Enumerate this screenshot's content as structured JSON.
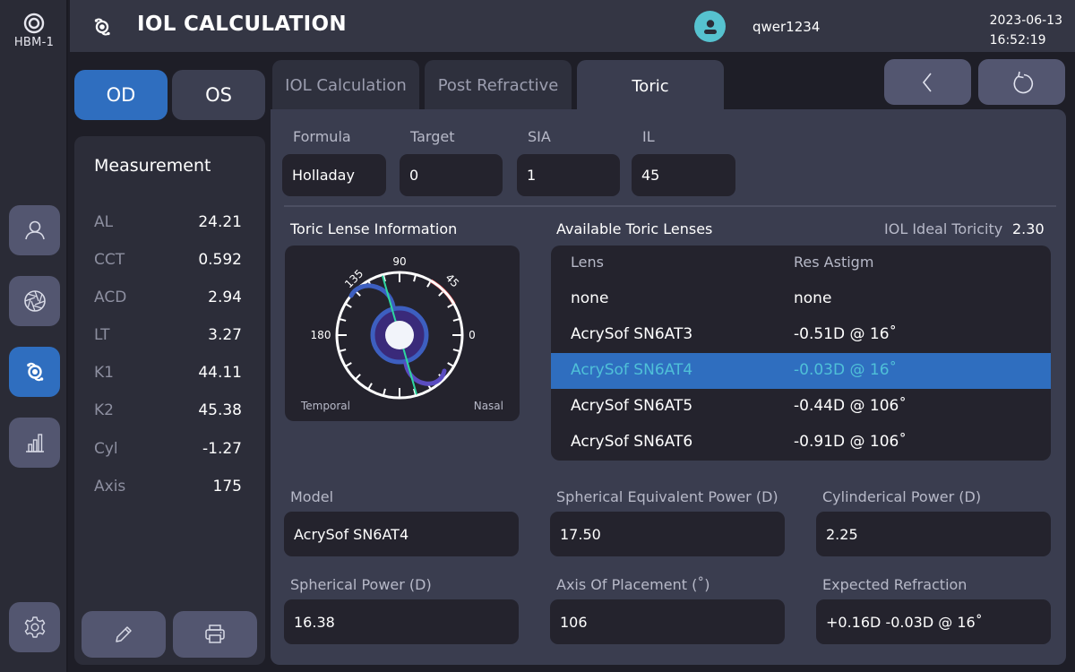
{
  "brand": {
    "name": "HBM-1",
    "logo_icon": "target-icon"
  },
  "header": {
    "app_icon": "iol-lens-icon",
    "title": "IOL CALCULATION",
    "user_icon": "user-avatar-icon",
    "username": "qwer1234",
    "date": "2023-06-13",
    "time": "16:52:19"
  },
  "rail": {
    "items": [
      {
        "icon": "patient-icon",
        "active": false
      },
      {
        "icon": "aperture-icon",
        "active": false
      },
      {
        "icon": "iol-lens-icon",
        "active": true
      },
      {
        "icon": "bar-chart-icon",
        "active": false
      }
    ],
    "settings_icon": "gear-icon"
  },
  "eye_toggle": {
    "od": "OD",
    "os": "OS",
    "selected": "OD"
  },
  "measurement": {
    "heading": "Measurement",
    "rows": [
      {
        "key": "AL",
        "value": "24.21"
      },
      {
        "key": "CCT",
        "value": "0.592"
      },
      {
        "key": "ACD",
        "value": "2.94"
      },
      {
        "key": "LT",
        "value": "3.27"
      },
      {
        "key": "K1",
        "value": "44.11"
      },
      {
        "key": "K2",
        "value": "45.38"
      },
      {
        "key": "Cyl",
        "value": "-1.27"
      },
      {
        "key": "Axis",
        "value": "175"
      }
    ],
    "edit_icon": "pencil-icon",
    "print_icon": "printer-icon"
  },
  "tabs": [
    {
      "label": "IOL Calculation",
      "active": false
    },
    {
      "label": "Post Refractive",
      "active": false
    },
    {
      "label": "Toric",
      "active": true
    }
  ],
  "nav": {
    "back_icon": "chevron-left-icon",
    "reset_icon": "rotate-ccw-icon"
  },
  "params": {
    "formula": {
      "label": "Formula",
      "value": "Holladay"
    },
    "target": {
      "label": "Target",
      "value": "0"
    },
    "sia": {
      "label": "SIA",
      "value": "1"
    },
    "il": {
      "label": "IL",
      "value": "45"
    }
  },
  "toric_info": {
    "heading": "Toric Lense Information",
    "dial": {
      "labels": {
        "deg90": "90",
        "deg135": "135",
        "deg45": "45",
        "deg180": "180",
        "deg0": "0"
      },
      "temporal": "Temporal",
      "nasal": "Nasal",
      "placement_axis_deg": 106,
      "highlight_range_deg": [
        30,
        60
      ],
      "colors": {
        "ring": "#ffffff",
        "highlight": "#e04848",
        "axis_line": "#2ed6a0",
        "lens": "#3d5fc0",
        "optic": "#3a2a7a",
        "center": "#f2f4fa"
      }
    }
  },
  "available_lenses": {
    "heading": "Available Toric Lenses",
    "ideal_toricity_label": "IOL Ideal Toricity",
    "ideal_toricity_value": "2.30",
    "columns": [
      "Lens",
      "Res Astigm"
    ],
    "rows": [
      {
        "lens": "none",
        "res": "none",
        "selected": false
      },
      {
        "lens": "AcrySof SN6AT3",
        "res": "-0.51D @ 16˚",
        "selected": false
      },
      {
        "lens": "AcrySof SN6AT4",
        "res": "-0.03D @ 16˚",
        "selected": true
      },
      {
        "lens": "AcrySof SN6AT5",
        "res": "-0.44D @ 106˚",
        "selected": false
      },
      {
        "lens": "AcrySof SN6AT6",
        "res": "-0.91D @ 106˚",
        "selected": false
      }
    ]
  },
  "results": {
    "model": {
      "label": "Model",
      "value": "AcrySof SN6AT4"
    },
    "se_power": {
      "label": "Spherical Equivalent Power (D)",
      "value": "17.50"
    },
    "cyl_power": {
      "label": "Cylinderical Power (D)",
      "value": "2.25"
    },
    "sph_power": {
      "label": "Spherical Power (D)",
      "value": "16.38"
    },
    "axis": {
      "label": "Axis Of Placement (˚)",
      "value": "106"
    },
    "expected": {
      "label": "Expected Refraction",
      "value": "+0.16D -0.03D @ 16˚"
    }
  }
}
